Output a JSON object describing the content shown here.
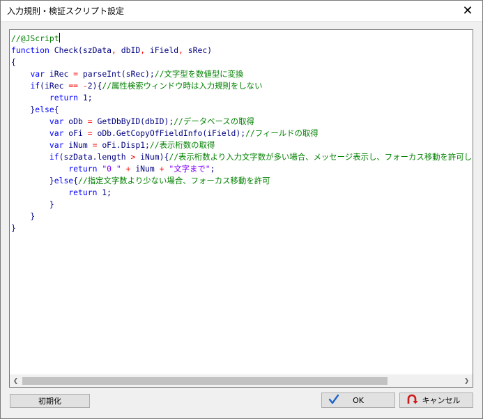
{
  "window": {
    "title": "入力規則・検証スクリプト設定",
    "close_glyph": "✕"
  },
  "editor": {
    "lines": [
      [
        [
          "cm",
          "//@JScript"
        ],
        [
          "caret",
          ""
        ]
      ],
      [
        [
          "kw",
          "function"
        ],
        [
          "pl",
          " Check(szData"
        ],
        [
          "op",
          ","
        ],
        [
          "pl",
          " dbID"
        ],
        [
          "op",
          ","
        ],
        [
          "pl",
          " iField"
        ],
        [
          "op",
          ","
        ],
        [
          "pl",
          " sRec)"
        ]
      ],
      [
        [
          "pl",
          "{"
        ]
      ],
      [
        [
          "pl",
          "    "
        ],
        [
          "kw",
          "var"
        ],
        [
          "pl",
          " iRec "
        ],
        [
          "op",
          "="
        ],
        [
          "pl",
          " parseInt(sRec);"
        ],
        [
          "cm",
          "//文字型を数値型に変換"
        ]
      ],
      [
        [
          "pl",
          "    "
        ],
        [
          "kw",
          "if"
        ],
        [
          "pl",
          "(iRec "
        ],
        [
          "op",
          "=="
        ],
        [
          "pl",
          " "
        ],
        [
          "op",
          "-"
        ],
        [
          "pl",
          "2){"
        ],
        [
          "cm",
          "//属性検索ウィンドウ時は入力規則をしない"
        ]
      ],
      [
        [
          "pl",
          "        "
        ],
        [
          "kw",
          "return"
        ],
        [
          "pl",
          " 1;"
        ]
      ],
      [
        [
          "pl",
          "    }"
        ],
        [
          "kw",
          "else"
        ],
        [
          "pl",
          "{"
        ]
      ],
      [
        [
          "pl",
          "        "
        ],
        [
          "kw",
          "var"
        ],
        [
          "pl",
          " oDb "
        ],
        [
          "op",
          "="
        ],
        [
          "pl",
          " GetDbByID(dbID);"
        ],
        [
          "cm",
          "//データベースの取得"
        ]
      ],
      [
        [
          "pl",
          "        "
        ],
        [
          "kw",
          "var"
        ],
        [
          "pl",
          " oFi "
        ],
        [
          "op",
          "="
        ],
        [
          "pl",
          " oDb.GetCopyOfFieldInfo(iField);"
        ],
        [
          "cm",
          "//フィールドの取得"
        ]
      ],
      [
        [
          "pl",
          "        "
        ],
        [
          "kw",
          "var"
        ],
        [
          "pl",
          " iNum "
        ],
        [
          "op",
          "="
        ],
        [
          "pl",
          " oFi.Disp1;"
        ],
        [
          "cm",
          "//表示桁数の取得"
        ]
      ],
      [
        [
          "pl",
          "        "
        ],
        [
          "kw",
          "if"
        ],
        [
          "pl",
          "(szData.length "
        ],
        [
          "op",
          ">"
        ],
        [
          "pl",
          " iNum){"
        ],
        [
          "cm",
          "//表示桁数より入力文字数が多い場合、メッセージ表示し、フォーカス移動を許可しない"
        ]
      ],
      [
        [
          "pl",
          "            "
        ],
        [
          "kw",
          "return"
        ],
        [
          "pl",
          " "
        ],
        [
          "str",
          "\"0 \""
        ],
        [
          "pl",
          " "
        ],
        [
          "op",
          "+"
        ],
        [
          "pl",
          " iNum "
        ],
        [
          "op",
          "+"
        ],
        [
          "pl",
          " "
        ],
        [
          "str",
          "\"文字まで\""
        ],
        [
          "pl",
          ";"
        ]
      ],
      [
        [
          "pl",
          "        }"
        ],
        [
          "kw",
          "else"
        ],
        [
          "pl",
          "{"
        ],
        [
          "cm",
          "//指定文字数より少ない場合、フォーカス移動を許可"
        ]
      ],
      [
        [
          "pl",
          "            "
        ],
        [
          "kw",
          "return"
        ],
        [
          "pl",
          " 1;"
        ]
      ],
      [
        [
          "pl",
          "        }"
        ]
      ],
      [
        [
          "pl",
          "    }"
        ]
      ],
      [
        [
          "pl",
          "}"
        ]
      ]
    ]
  },
  "scrollbar": {
    "left_arrow": "❮",
    "right_arrow": "❯",
    "thumb_fraction": 0.83
  },
  "buttons": {
    "initialize_label": "初期化",
    "ok_label": "OK",
    "cancel_label": "キャンセル"
  },
  "colors": {
    "comment": "#008000",
    "keyword": "#0000ff",
    "operator": "#ff0000",
    "string": "#8000ff",
    "plain": "#000080",
    "ok_icon": "#1e64c8",
    "cancel_icon": "#d01818"
  },
  "icons": {
    "ok": "checkmark-icon",
    "cancel": "undo-arrow-icon"
  }
}
